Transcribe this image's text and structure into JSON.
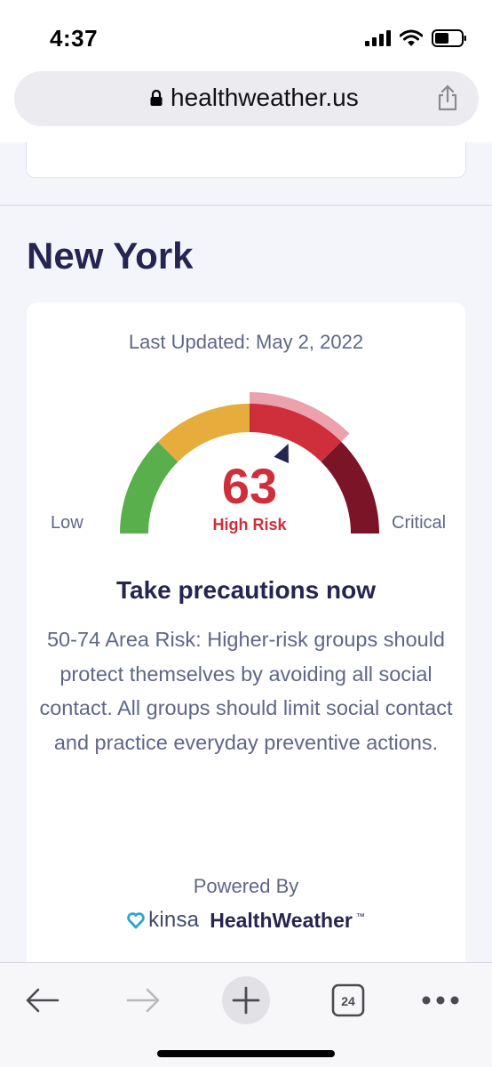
{
  "status_bar": {
    "time": "4:37"
  },
  "browser": {
    "url": "healthweather.us"
  },
  "page": {
    "city": "New York",
    "last_updated": "Last Updated: May 2, 2022",
    "gauge": {
      "score": "63",
      "score_value": 63,
      "range_min": 0,
      "range_max": 100,
      "level": "High Risk",
      "min_label": "Low",
      "max_label": "Critical",
      "segments": [
        {
          "name": "low",
          "from": 0,
          "to": 25,
          "color": "#5aaf4d"
        },
        {
          "name": "moderate",
          "from": 25,
          "to": 50,
          "color": "#e6ad3c"
        },
        {
          "name": "high",
          "from": 50,
          "to": 75,
          "color": "#cf2e3b"
        },
        {
          "name": "critical",
          "from": 75,
          "to": 100,
          "color": "#7a1426"
        }
      ],
      "highlight_color": "#eba2ac",
      "indicator_color": "#262450"
    },
    "advice_title": "Take precautions now",
    "advice_body": "50-74 Area Risk: Higher-risk groups should protect themselves by avoiding all social contact. All groups should limit social contact and practice everyday preventive actions.",
    "powered_by": "Powered By",
    "brand": {
      "kinsa": "kinsa",
      "healthweather": "HealthWeather",
      "tm": "™"
    }
  },
  "toolbar": {
    "tab_count": "24"
  },
  "icons": [
    "lock-icon",
    "share-icon",
    "back-arrow-icon",
    "forward-arrow-icon",
    "new-tab-plus-icon",
    "tabs-icon",
    "more-icon",
    "kinsa-heart-icon",
    "signal-icon",
    "wifi-icon",
    "battery-icon"
  ]
}
